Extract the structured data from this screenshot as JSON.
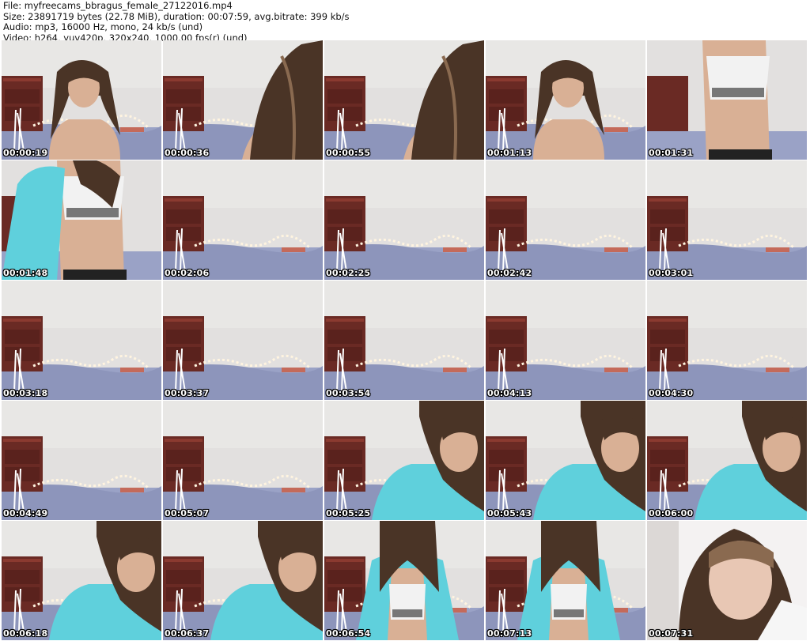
{
  "header": {
    "file": "File: myfreecams_bbragus_female_27122016.mp4",
    "size": "Size: 23891719 bytes (22.78 MiB), duration: 00:07:59, avg.bitrate: 399 kb/s",
    "audio": "Audio: mp3, 16000 Hz, mono, 24 kb/s (und)",
    "video": "Video: h264, yuv420p, 320x240, 1000.00 fps(r) (und)"
  },
  "thumbnails": [
    {
      "time": "00:00:19",
      "scene": "person-front"
    },
    {
      "time": "00:00:36",
      "scene": "hair-close"
    },
    {
      "time": "00:00:55",
      "scene": "hair-close"
    },
    {
      "time": "00:01:13",
      "scene": "person-front"
    },
    {
      "time": "00:01:31",
      "scene": "torso"
    },
    {
      "time": "00:01:48",
      "scene": "torso-jacket"
    },
    {
      "time": "00:02:06",
      "scene": "empty-room"
    },
    {
      "time": "00:02:25",
      "scene": "empty-room"
    },
    {
      "time": "00:02:42",
      "scene": "empty-room"
    },
    {
      "time": "00:03:01",
      "scene": "empty-room"
    },
    {
      "time": "00:03:18",
      "scene": "empty-room"
    },
    {
      "time": "00:03:37",
      "scene": "empty-room"
    },
    {
      "time": "00:03:54",
      "scene": "empty-room"
    },
    {
      "time": "00:04:13",
      "scene": "empty-room"
    },
    {
      "time": "00:04:30",
      "scene": "empty-room"
    },
    {
      "time": "00:04:49",
      "scene": "empty-room"
    },
    {
      "time": "00:05:07",
      "scene": "empty-room"
    },
    {
      "time": "00:05:25",
      "scene": "jacket-face"
    },
    {
      "time": "00:05:43",
      "scene": "jacket-face"
    },
    {
      "time": "00:06:00",
      "scene": "jacket-face"
    },
    {
      "time": "00:06:18",
      "scene": "jacket-face"
    },
    {
      "time": "00:06:37",
      "scene": "jacket-face"
    },
    {
      "time": "00:06:54",
      "scene": "jacket-torso"
    },
    {
      "time": "00:07:13",
      "scene": "jacket-torso"
    },
    {
      "time": "00:07:31",
      "scene": "closeup-face"
    }
  ],
  "colors": {
    "wall": "#e2e0df",
    "bed": "#9aa2c6",
    "dresser": "#6a2a24",
    "hair": "#4a3426",
    "skin": "#d9b095",
    "jacket": "#5fd0dc",
    "top": "#f2f2f2",
    "lights": "#fff4e0"
  }
}
